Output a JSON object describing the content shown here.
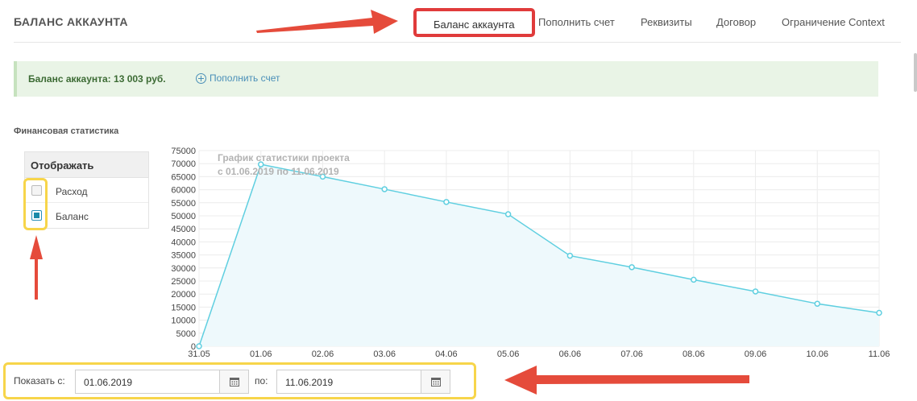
{
  "header": {
    "title": "БАЛАНС АККАУНТА"
  },
  "nav": {
    "tabs": [
      {
        "label": "Баланс аккаунта",
        "active": true
      },
      {
        "label": "Пополнить счет"
      },
      {
        "label": "Реквизиты"
      },
      {
        "label": "Договор"
      },
      {
        "label": "Ограничение Context"
      }
    ]
  },
  "balance": {
    "text": "Баланс аккаунта: 13 003 руб.",
    "topup_label": "Пополнить счет",
    "topup_icon": "plus-circle-icon"
  },
  "stats": {
    "section_title": "Финансовая статистика",
    "display_header": "Отображать",
    "options": [
      {
        "label": "Расход",
        "checked": false
      },
      {
        "label": "Баланс",
        "checked": true
      }
    ]
  },
  "chart_data": {
    "type": "area",
    "title": "График статистики проекта",
    "subtitle": "с 01.06.2019 по 11.06.2019",
    "x": [
      "31.05",
      "01.06",
      "02.06",
      "03.06",
      "04.06",
      "05.06",
      "06.06",
      "07.06",
      "08.06",
      "09.06",
      "10.06",
      "11.06"
    ],
    "series": [
      {
        "values": [
          0,
          69700,
          65000,
          60200,
          55300,
          50600,
          34700,
          30300,
          25500,
          21000,
          16300,
          12800
        ]
      }
    ],
    "y_ticks": [
      "0",
      "5000",
      "10000",
      "15000",
      "20000",
      "25000",
      "30000",
      "35000",
      "40000",
      "45000",
      "50000",
      "55000",
      "60000",
      "65000",
      "70000",
      "75000"
    ],
    "ylim": [
      0,
      75000
    ],
    "grid": true,
    "legend": "none",
    "line_color": "#5fcfe0",
    "fill_color": "#eef9fc"
  },
  "date_range": {
    "from_label": "Показать с:",
    "from_value": "01.06.2019",
    "to_label": "по:",
    "to_value": "11.06.2019",
    "calendar_icon": "calendar-icon"
  },
  "colors": {
    "highlight_red": "#e03b3b",
    "highlight_yellow": "#f7d54a"
  }
}
